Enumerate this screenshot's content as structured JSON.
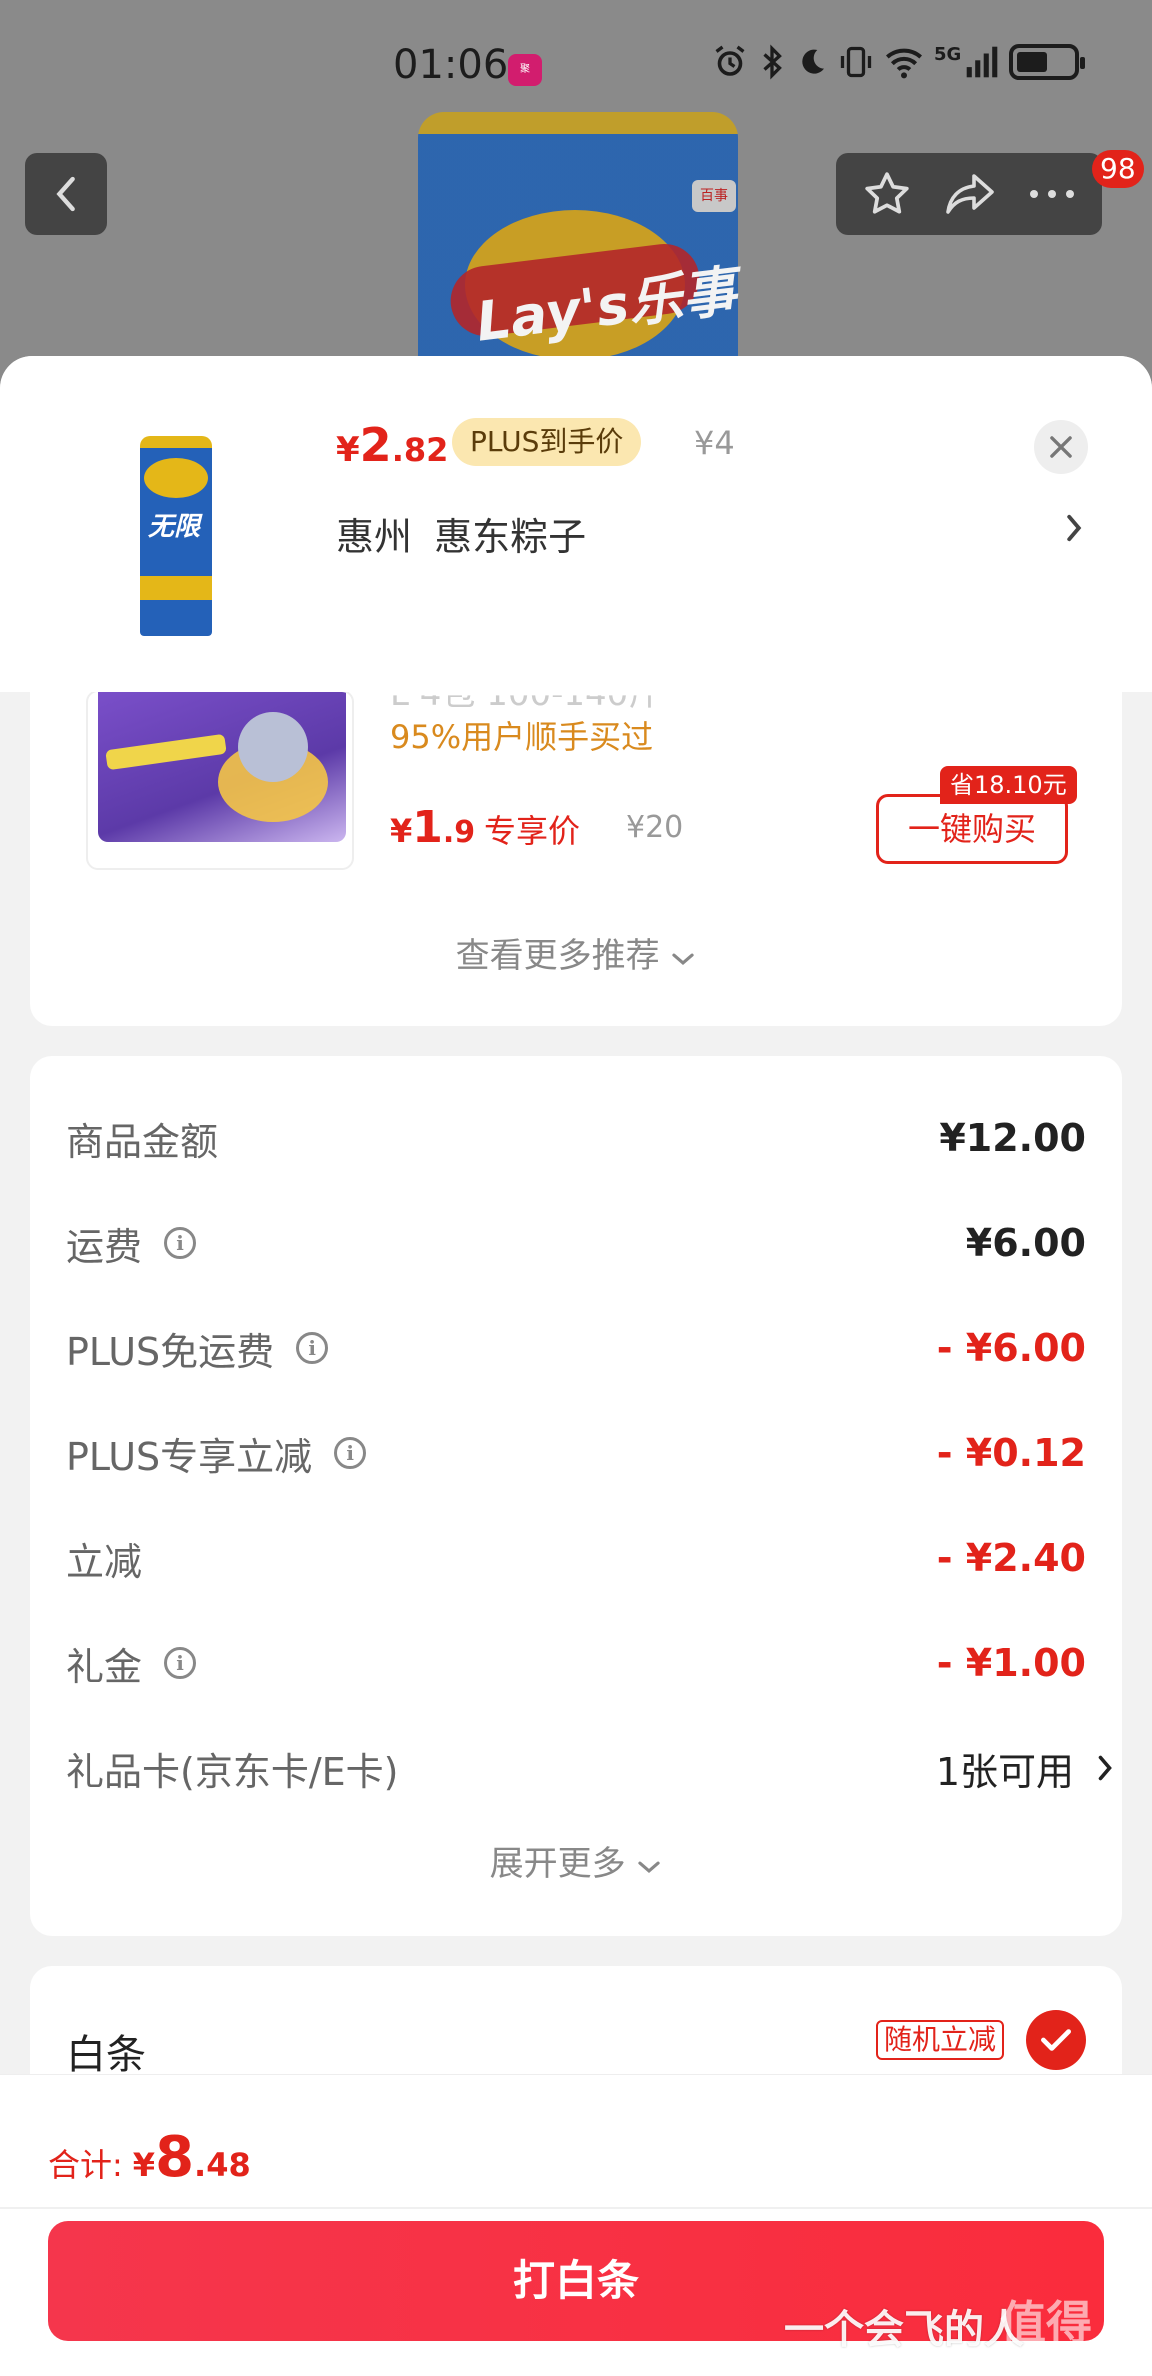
{
  "status_bar": {
    "time": "01:06",
    "network": "5G",
    "icons": [
      "alarm-icon",
      "bluetooth-icon",
      "moon-icon",
      "vibrate-icon",
      "wifi-icon",
      "signal-icon",
      "battery-icon"
    ]
  },
  "top_nav": {
    "back": "back-icon",
    "actions": [
      "star-icon",
      "share-icon",
      "more-icon"
    ],
    "message_count": "98"
  },
  "product_sheet": {
    "price_currency": "¥",
    "price_int": "2",
    "price_dec": ".82",
    "plus_tag": "PLUS到手价",
    "original_price": "¥4",
    "address": "惠州 惠东粽子"
  },
  "recommendation": {
    "bought_text": "95%用户顺手买过",
    "price_currency": "¥",
    "price_int": "1",
    "price_dec": ".9",
    "exclusive_label": "专享价",
    "original_price": "¥20",
    "buy_button": "一键购买",
    "save_tag": "省18.10元",
    "more_label": "查看更多推荐"
  },
  "cost_breakdown": {
    "rows": [
      {
        "label": "商品金额",
        "value": "¥12.00"
      },
      {
        "label": "运费",
        "value": "¥6.00"
      },
      {
        "label": "PLUS免运费",
        "value": "- ¥6.00"
      },
      {
        "label": "PLUS专享立减",
        "value": "- ¥0.12"
      },
      {
        "label": "立减",
        "value": "- ¥2.40"
      },
      {
        "label": "礼金",
        "value": "- ¥1.00"
      },
      {
        "label": "礼品卡(京东卡/E卡)",
        "value": "1张可用"
      }
    ],
    "expand_label": "展开更多"
  },
  "payment": {
    "method": "白条",
    "promo_tag": "随机立减"
  },
  "bottom_bar": {
    "total_label": "合计:",
    "total_currency": "¥",
    "total_int": "8",
    "total_dec": ".48",
    "pay_button": "打白条"
  },
  "colors": {
    "accent": "#e2231a",
    "plus_tag_bg": "#fbe7b0",
    "bought_text": "#d98a1e"
  }
}
